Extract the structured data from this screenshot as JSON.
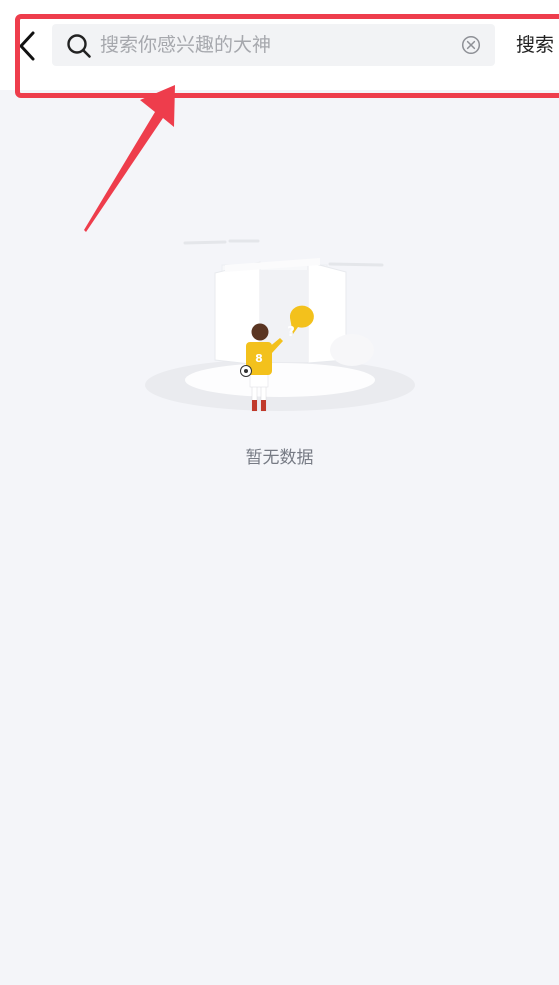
{
  "header": {
    "search": {
      "placeholder": "搜索你感兴趣的大神",
      "value": ""
    },
    "search_button_label": "搜索"
  },
  "empty_state": {
    "message": "暂无数据",
    "jersey_number": "8",
    "speech_bubble": "?"
  },
  "colors": {
    "background": "#f4f5f9",
    "header": "#ffffff",
    "annotation_red": "#ee3d4c",
    "jersey_yellow": "#f3c11c"
  },
  "icons": [
    "back-arrow-icon",
    "search-icon",
    "clear-icon"
  ]
}
